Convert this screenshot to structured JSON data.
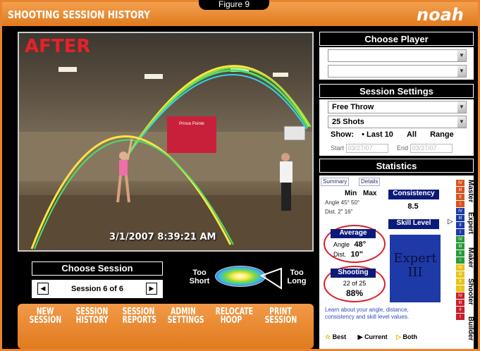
{
  "figure_tag": "Figure 9",
  "title_bar": {
    "title": "SHOOTING SESSION HISTORY",
    "logo": "noah"
  },
  "video": {
    "overlay_label": "AFTER",
    "timestamp": "3/1/2007 8:39:21 AM",
    "banner_text": "Prince Pointe"
  },
  "choose_session": {
    "title": "Choose Session",
    "prev_icon": "left-arrow-icon",
    "next_icon": "right-arrow-icon",
    "label": "Session 6 of 6"
  },
  "meter": {
    "too_short": "Too Short",
    "too_long": "Too Long"
  },
  "nav": {
    "items": [
      {
        "label": "NEW SESSION"
      },
      {
        "label": "SESSION HISTORY"
      },
      {
        "label": "SESSION REPORTS"
      },
      {
        "label": "ADMIN SETTINGS"
      },
      {
        "label": "RELOCATE HOOP"
      },
      {
        "label": "PRINT SESSION"
      }
    ]
  },
  "choose_player": {
    "title": "Choose Player",
    "select1": "",
    "select2": ""
  },
  "session_settings": {
    "title": "Session Settings",
    "shot_type": "Free Throw",
    "shot_count": "25 Shots",
    "show_label": "Show:",
    "option_last": "Last 10",
    "option_all": "All",
    "option_range": "Range",
    "start_label": "Start",
    "start_value": "03/27/07",
    "end_label": "End",
    "end_value": "03/27/07"
  },
  "statistics": {
    "title": "Statistics",
    "tab_summary": "Summary",
    "tab_details": "Details",
    "min_label": "Min",
    "max_label": "Max",
    "angle_row": "Angle 45°  50°",
    "dist_row": "Dist. 2\"   16\"",
    "consistency_label": "Consistency",
    "consistency_value": "8.5",
    "average_label": "Average",
    "avg_angle_label": "Angle",
    "avg_angle_value": "48°",
    "avg_dist_label": "Dist.",
    "avg_dist_value": "10\"",
    "skill_label": "Skill Level",
    "skill_value_1": "Expert",
    "skill_value_2": "III",
    "shooting_label": "Shooting",
    "shooting_count": "22 of 25",
    "shooting_pct": "88%",
    "learn_text": "Learn about your angle, distance, consistency and skill level values.",
    "legend_best": "Best",
    "legend_current": "Current",
    "legend_both": "Both"
  },
  "skill_scale": {
    "levels": [
      "Master",
      "Expert",
      "Shooter",
      "Maker",
      "Builder"
    ],
    "tiers": [
      "IV",
      "III",
      "II",
      "I"
    ]
  },
  "colors": {
    "accent": "#e8842e",
    "header": "#000000",
    "skill_box": "#1e3aa6",
    "highlight_circle": "#d8202a"
  }
}
